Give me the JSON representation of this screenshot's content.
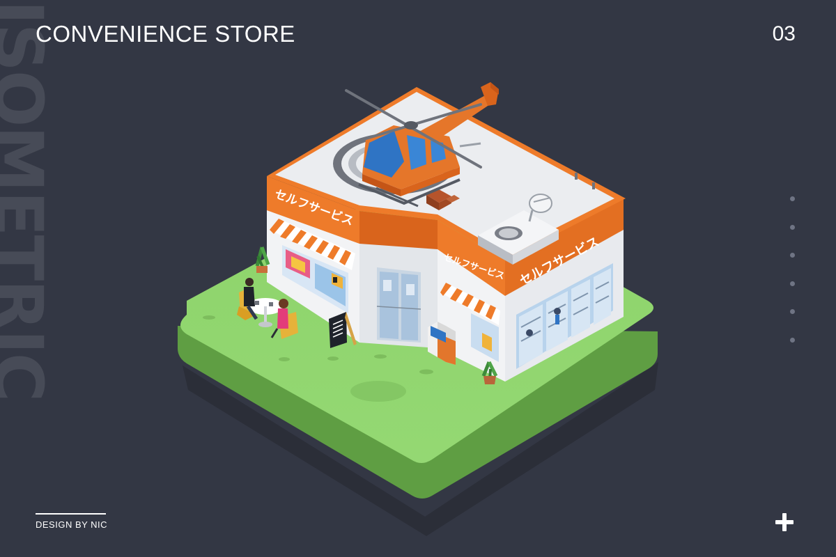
{
  "header": {
    "title": "CONVENIENCE STORE",
    "page_number": "03"
  },
  "side_text": "ISOMETRIC",
  "footer": {
    "credit": "DESIGN BY NIC",
    "plus_icon": "plus-icon"
  },
  "pagination_dots": 6,
  "store": {
    "sign_left": "セルフサービス",
    "sign_center": "セルフサービス",
    "sign_right": "セルフサービス"
  },
  "colors": {
    "background": "#333744",
    "accent_orange": "#ee7b2a",
    "grass": "#8fd46c",
    "grass_side": "#5f9e43",
    "wall": "#f2f3f5",
    "roof": "#ebedf0",
    "helicopter_body": "#e5762a",
    "window_blue": "#2f74c4"
  }
}
